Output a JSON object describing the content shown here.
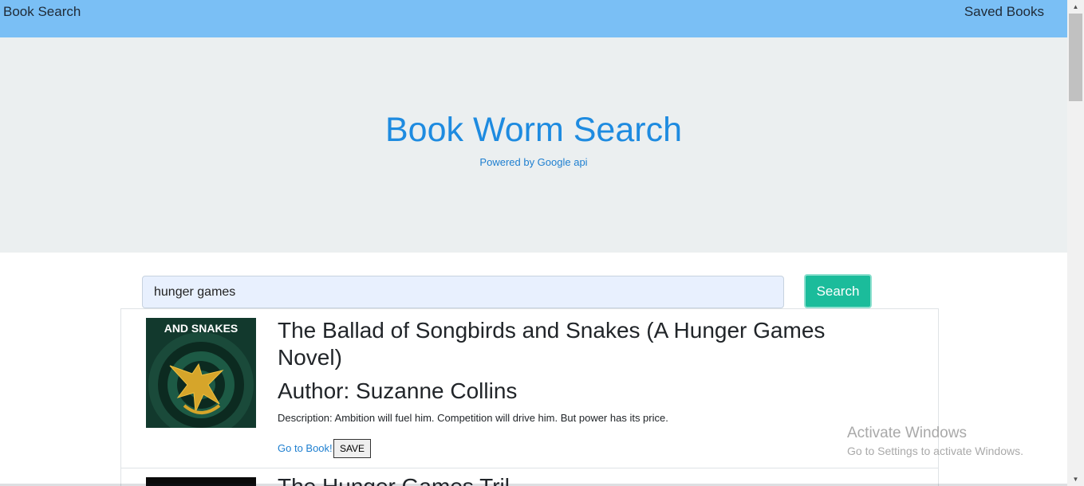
{
  "navbar": {
    "brand": "Book Search",
    "saved_link": "Saved Books",
    "background": "#7abff5"
  },
  "jumbotron": {
    "title": "Book Worm Search",
    "subtitle": "Powered by Google api"
  },
  "search": {
    "value": "hunger games",
    "button_label": "Search",
    "button_color": "#1bbc9b"
  },
  "results": [
    {
      "title": "The Ballad of Songbirds and Snakes (A Hunger Games Novel)",
      "author": "Author: Suzanne Collins",
      "description": "Description: Ambition will fuel him. Competition will drive him. But power has its price.",
      "link_label": "Go to Book!",
      "save_label": "SAVE",
      "cover_text": "AND SNAKES",
      "cover_icon": "mockingjay-icon"
    },
    {
      "title": "The Hunger Games Tril"
    }
  ],
  "watermark": {
    "title": "Activate Windows",
    "subtitle": "Go to Settings to activate Windows."
  },
  "scrollbar": {
    "up_icon": "scroll-up-arrow-icon",
    "down_icon": "scroll-down-arrow-icon"
  }
}
